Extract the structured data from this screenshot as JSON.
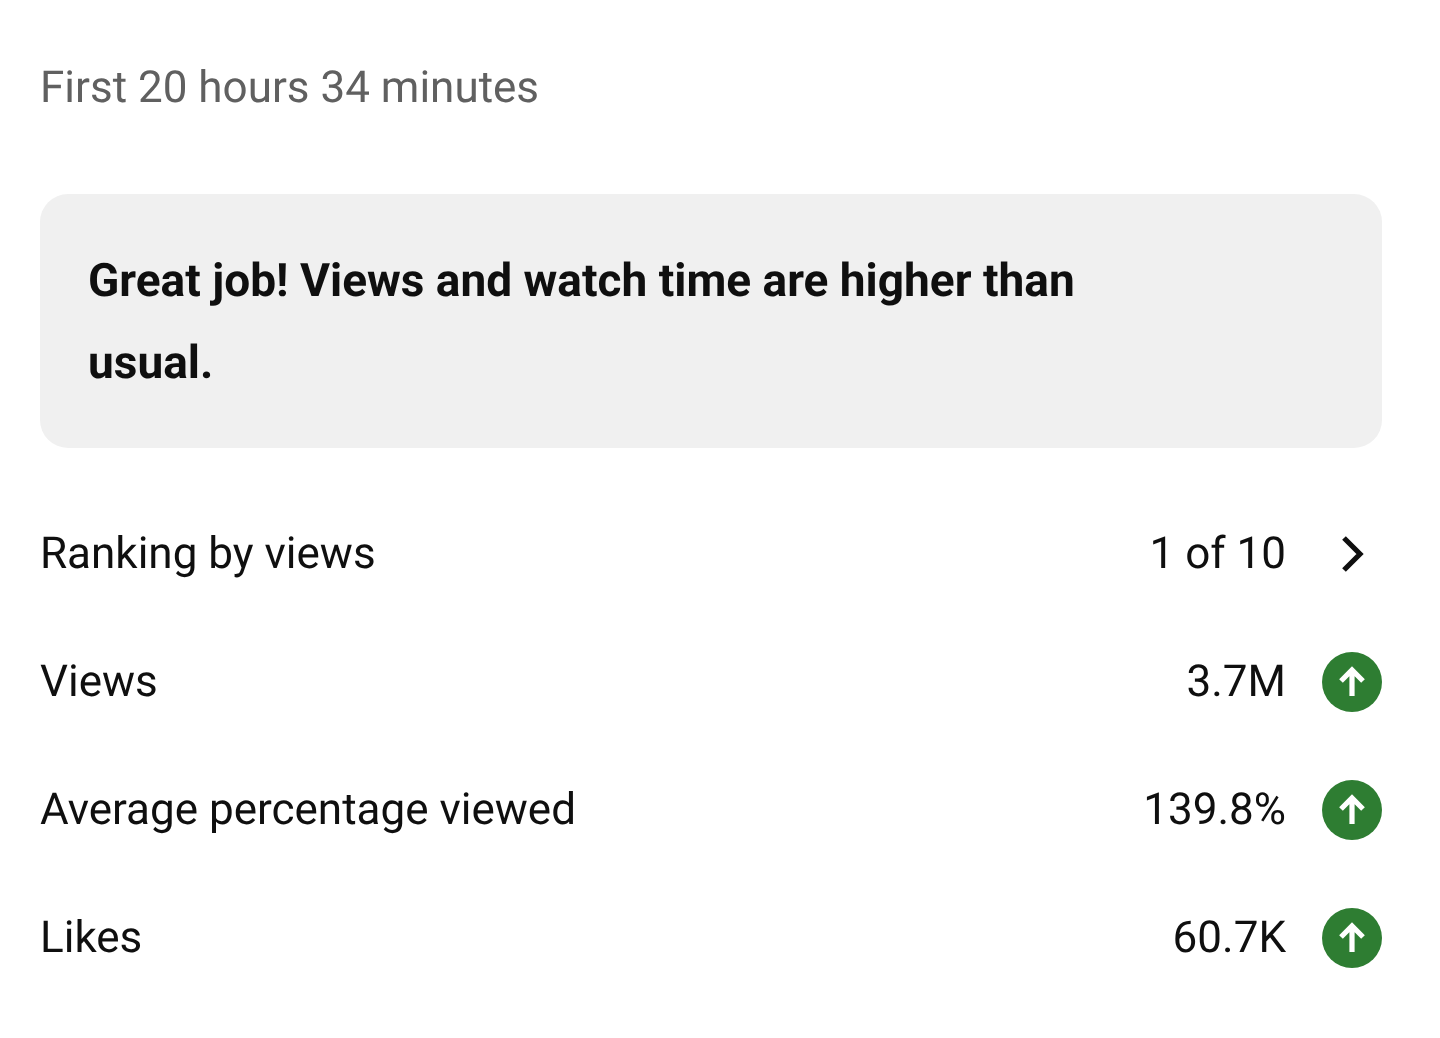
{
  "period": "First 20 hours 34 minutes",
  "message": "Great job! Views and watch time are higher than usual.",
  "rows": [
    {
      "label": "Ranking by views",
      "value": "1 of 10",
      "kind": "link"
    },
    {
      "label": "Views",
      "value": "3.7M",
      "kind": "trend",
      "rising": true
    },
    {
      "label": "Average percentage viewed",
      "value": "139.8%",
      "kind": "trend",
      "rising": true
    },
    {
      "label": "Likes",
      "value": "60.7K",
      "kind": "trend",
      "rising": true
    }
  ]
}
